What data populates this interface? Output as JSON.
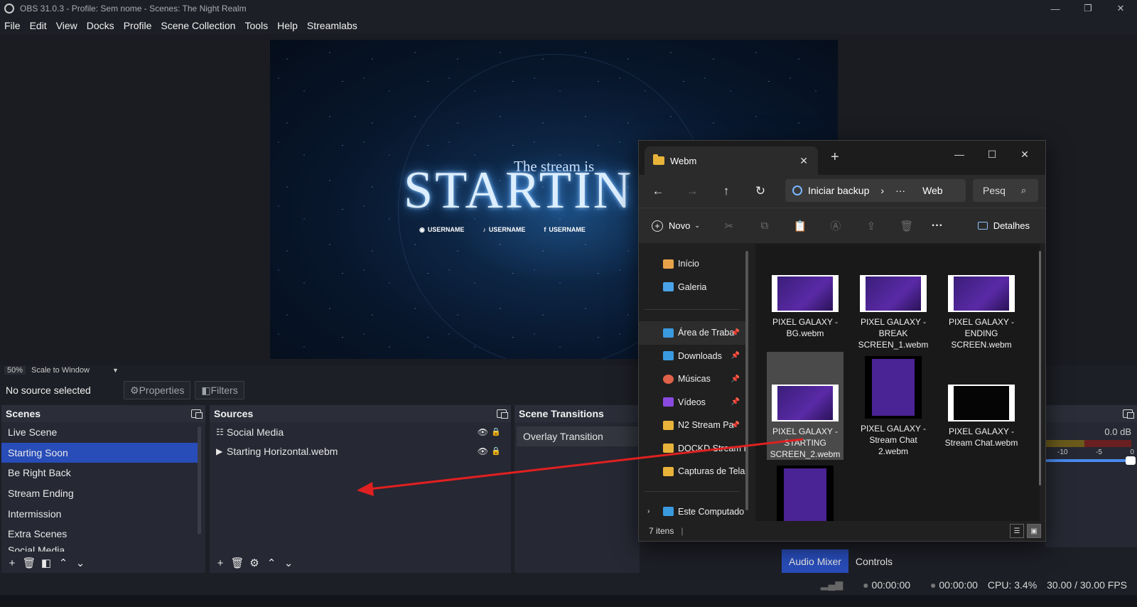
{
  "window": {
    "title": "OBS 31.0.3 - Profile: Sem nome - Scenes: The Night Realm",
    "controls": [
      "—",
      "❐",
      "✕"
    ]
  },
  "menubar": [
    "File",
    "Edit",
    "View",
    "Docks",
    "Profile",
    "Scene Collection",
    "Tools",
    "Help",
    "Streamlabs"
  ],
  "preview": {
    "subtitle": "The stream is",
    "headline": "STARTIN",
    "socials": [
      {
        "icon": "twitch-icon",
        "glyph": "◉",
        "label": "USERNAME"
      },
      {
        "icon": "tiktok-icon",
        "glyph": "♪",
        "label": "USERNAME"
      },
      {
        "icon": "facebook-icon",
        "glyph": "f",
        "label": "USERNAME"
      }
    ]
  },
  "zoombar": {
    "zoom": "50%",
    "scale_mode": "Scale to Window"
  },
  "contextbar": {
    "selection": "No source selected",
    "properties": "Properties",
    "filters": "Filters"
  },
  "scenes": {
    "title": "Scenes",
    "items": [
      "Live Scene",
      "Starting Soon",
      "Be Right Back",
      "Stream Ending",
      "Intermission",
      "Extra Scenes",
      "Social Media"
    ],
    "selected_index": 1
  },
  "sources": {
    "title": "Sources",
    "items": [
      {
        "icon": "group-icon",
        "glyph": "☷",
        "label": "Social Media"
      },
      {
        "icon": "media-play-icon",
        "glyph": "▶",
        "label": "Starting Horizontal.webm"
      }
    ]
  },
  "transitions": {
    "title": "Scene Transitions",
    "current": "Overlay Transition"
  },
  "audio": {
    "db": "0.0 dB",
    "ticks": [
      "-10",
      "-5",
      "0"
    ],
    "tabs": [
      "Audio Mixer",
      "Controls"
    ]
  },
  "statusbar": {
    "rec_time": "00:00:00",
    "stream_time": "00:00:00",
    "cpu": "CPU: 3.4%",
    "fps": "30.00 / 30.00 FPS"
  },
  "explorer": {
    "tab_title": "Webm",
    "address": {
      "root": "Iniciar backup",
      "ellipsis": "···",
      "leaf": "Web"
    },
    "search_placeholder": "Pesq",
    "new_label": "Novo",
    "details_label": "Detalhes",
    "nav": [
      {
        "label": "Início",
        "icon": "home-icon",
        "color": "#e8a34a",
        "pinned": false
      },
      {
        "label": "Galeria",
        "icon": "gallery-icon",
        "color": "#4aa3e8",
        "pinned": false
      },
      {
        "label": "Área de Traba",
        "icon": "desktop-icon",
        "color": "#3a9ae0",
        "pinned": true
      },
      {
        "label": "Downloads",
        "icon": "download-icon",
        "color": "#3a9ae0",
        "pinned": true
      },
      {
        "label": "Músicas",
        "icon": "music-icon",
        "color": "#e0614a",
        "pinned": true
      },
      {
        "label": "Vídeos",
        "icon": "video-icon",
        "color": "#8a4ae0",
        "pinned": true
      },
      {
        "label": "N2 Stream Pa",
        "icon": "folder-icon",
        "color": "#e8b33a",
        "pinned": true
      },
      {
        "label": "DOCKD Stream I",
        "icon": "folder-icon",
        "color": "#e8b33a",
        "pinned": false
      },
      {
        "label": "Capturas de Tela",
        "icon": "folder-icon",
        "color": "#e8b33a",
        "pinned": false
      },
      {
        "label": "Este Computado",
        "icon": "computer-icon",
        "color": "#3a9ae0",
        "pinned": false
      }
    ],
    "files": [
      {
        "name": "PIXEL GALAXY - BG.webm",
        "thumb": "film"
      },
      {
        "name": "PIXEL GALAXY - BREAK SCREEN_1.webm",
        "thumb": "film"
      },
      {
        "name": "PIXEL GALAXY - ENDING SCREEN.webm",
        "thumb": "film"
      },
      {
        "name": "PIXEL GALAXY - STARTING SCREEN_2.webm",
        "thumb": "film"
      },
      {
        "name": "PIXEL GALAXY - Stream Chat 2.webm",
        "thumb": "tall"
      },
      {
        "name": "PIXEL GALAXY - Stream Chat.webm",
        "thumb": "dark"
      },
      {
        "name": "",
        "thumb": "tall"
      }
    ],
    "selected_file_index": 3,
    "item_count": "7 itens"
  },
  "colors": {
    "accent": "#284cb8",
    "arrow": "#e02020"
  }
}
